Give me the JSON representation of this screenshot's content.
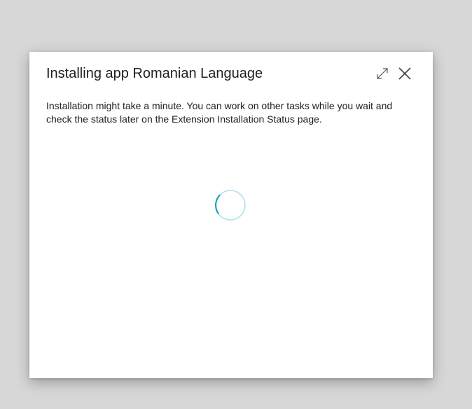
{
  "dialog": {
    "title": "Installing app Romanian Language",
    "message": "Installation might take a minute. You can work on other tasks while you wait and check the status later on the Extension Installation Status page."
  },
  "icons": {
    "expand": "expand-icon",
    "close": "close-icon",
    "spinner": "loading-spinner"
  },
  "colors": {
    "accent": "#00a0b0",
    "spinner_track": "#aee3ea"
  }
}
